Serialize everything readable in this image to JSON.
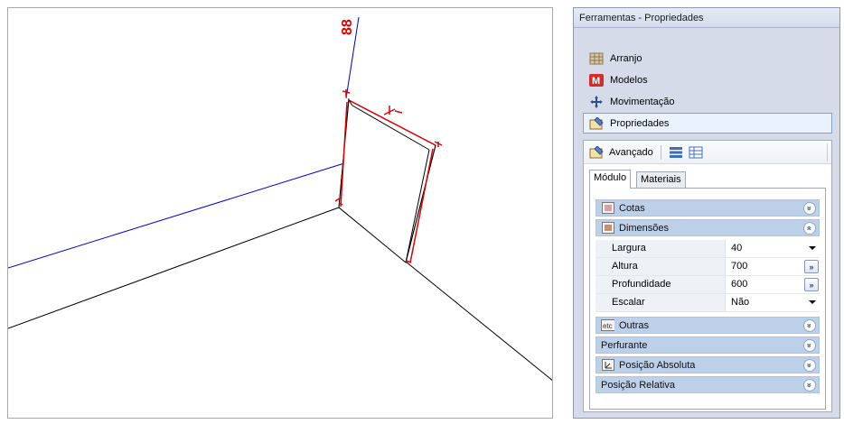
{
  "panel": {
    "title": "Ferramentas - Propriedades",
    "nav": [
      {
        "label": "Arranjo",
        "icon": "arrangement-icon"
      },
      {
        "label": "Modelos",
        "icon": "models-icon"
      },
      {
        "label": "Movimentação",
        "icon": "move-icon"
      },
      {
        "label": "Propriedades",
        "icon": "properties-icon",
        "selected": true
      }
    ],
    "toolbar": {
      "label": "Avançado"
    },
    "tabs": [
      "Módulo",
      "Materiais"
    ],
    "sections": {
      "cotas": "Cotas",
      "dimensoes": "Dimensões",
      "outras": "Outras",
      "perfurante": "Perfurante",
      "posicao_absoluta": "Posição Absoluta",
      "posicao_relativa": "Posição Relativa"
    },
    "properties": [
      {
        "name": "Largura",
        "value": "40",
        "control": "dropdown"
      },
      {
        "name": "Altura",
        "value": "700",
        "control": "button"
      },
      {
        "name": "Profundidade",
        "value": "600",
        "control": "button"
      },
      {
        "name": "Escalar",
        "value": "Não",
        "control": "dropdown"
      }
    ],
    "expand_glyph": "»",
    "collapse_glyph": "«",
    "ellipsis_glyph": "»"
  },
  "viewport": {
    "axis_label": "88",
    "colors": {
      "axis_blue": "#0000cc",
      "marker_red": "#e00000",
      "edge": "#000000"
    }
  }
}
